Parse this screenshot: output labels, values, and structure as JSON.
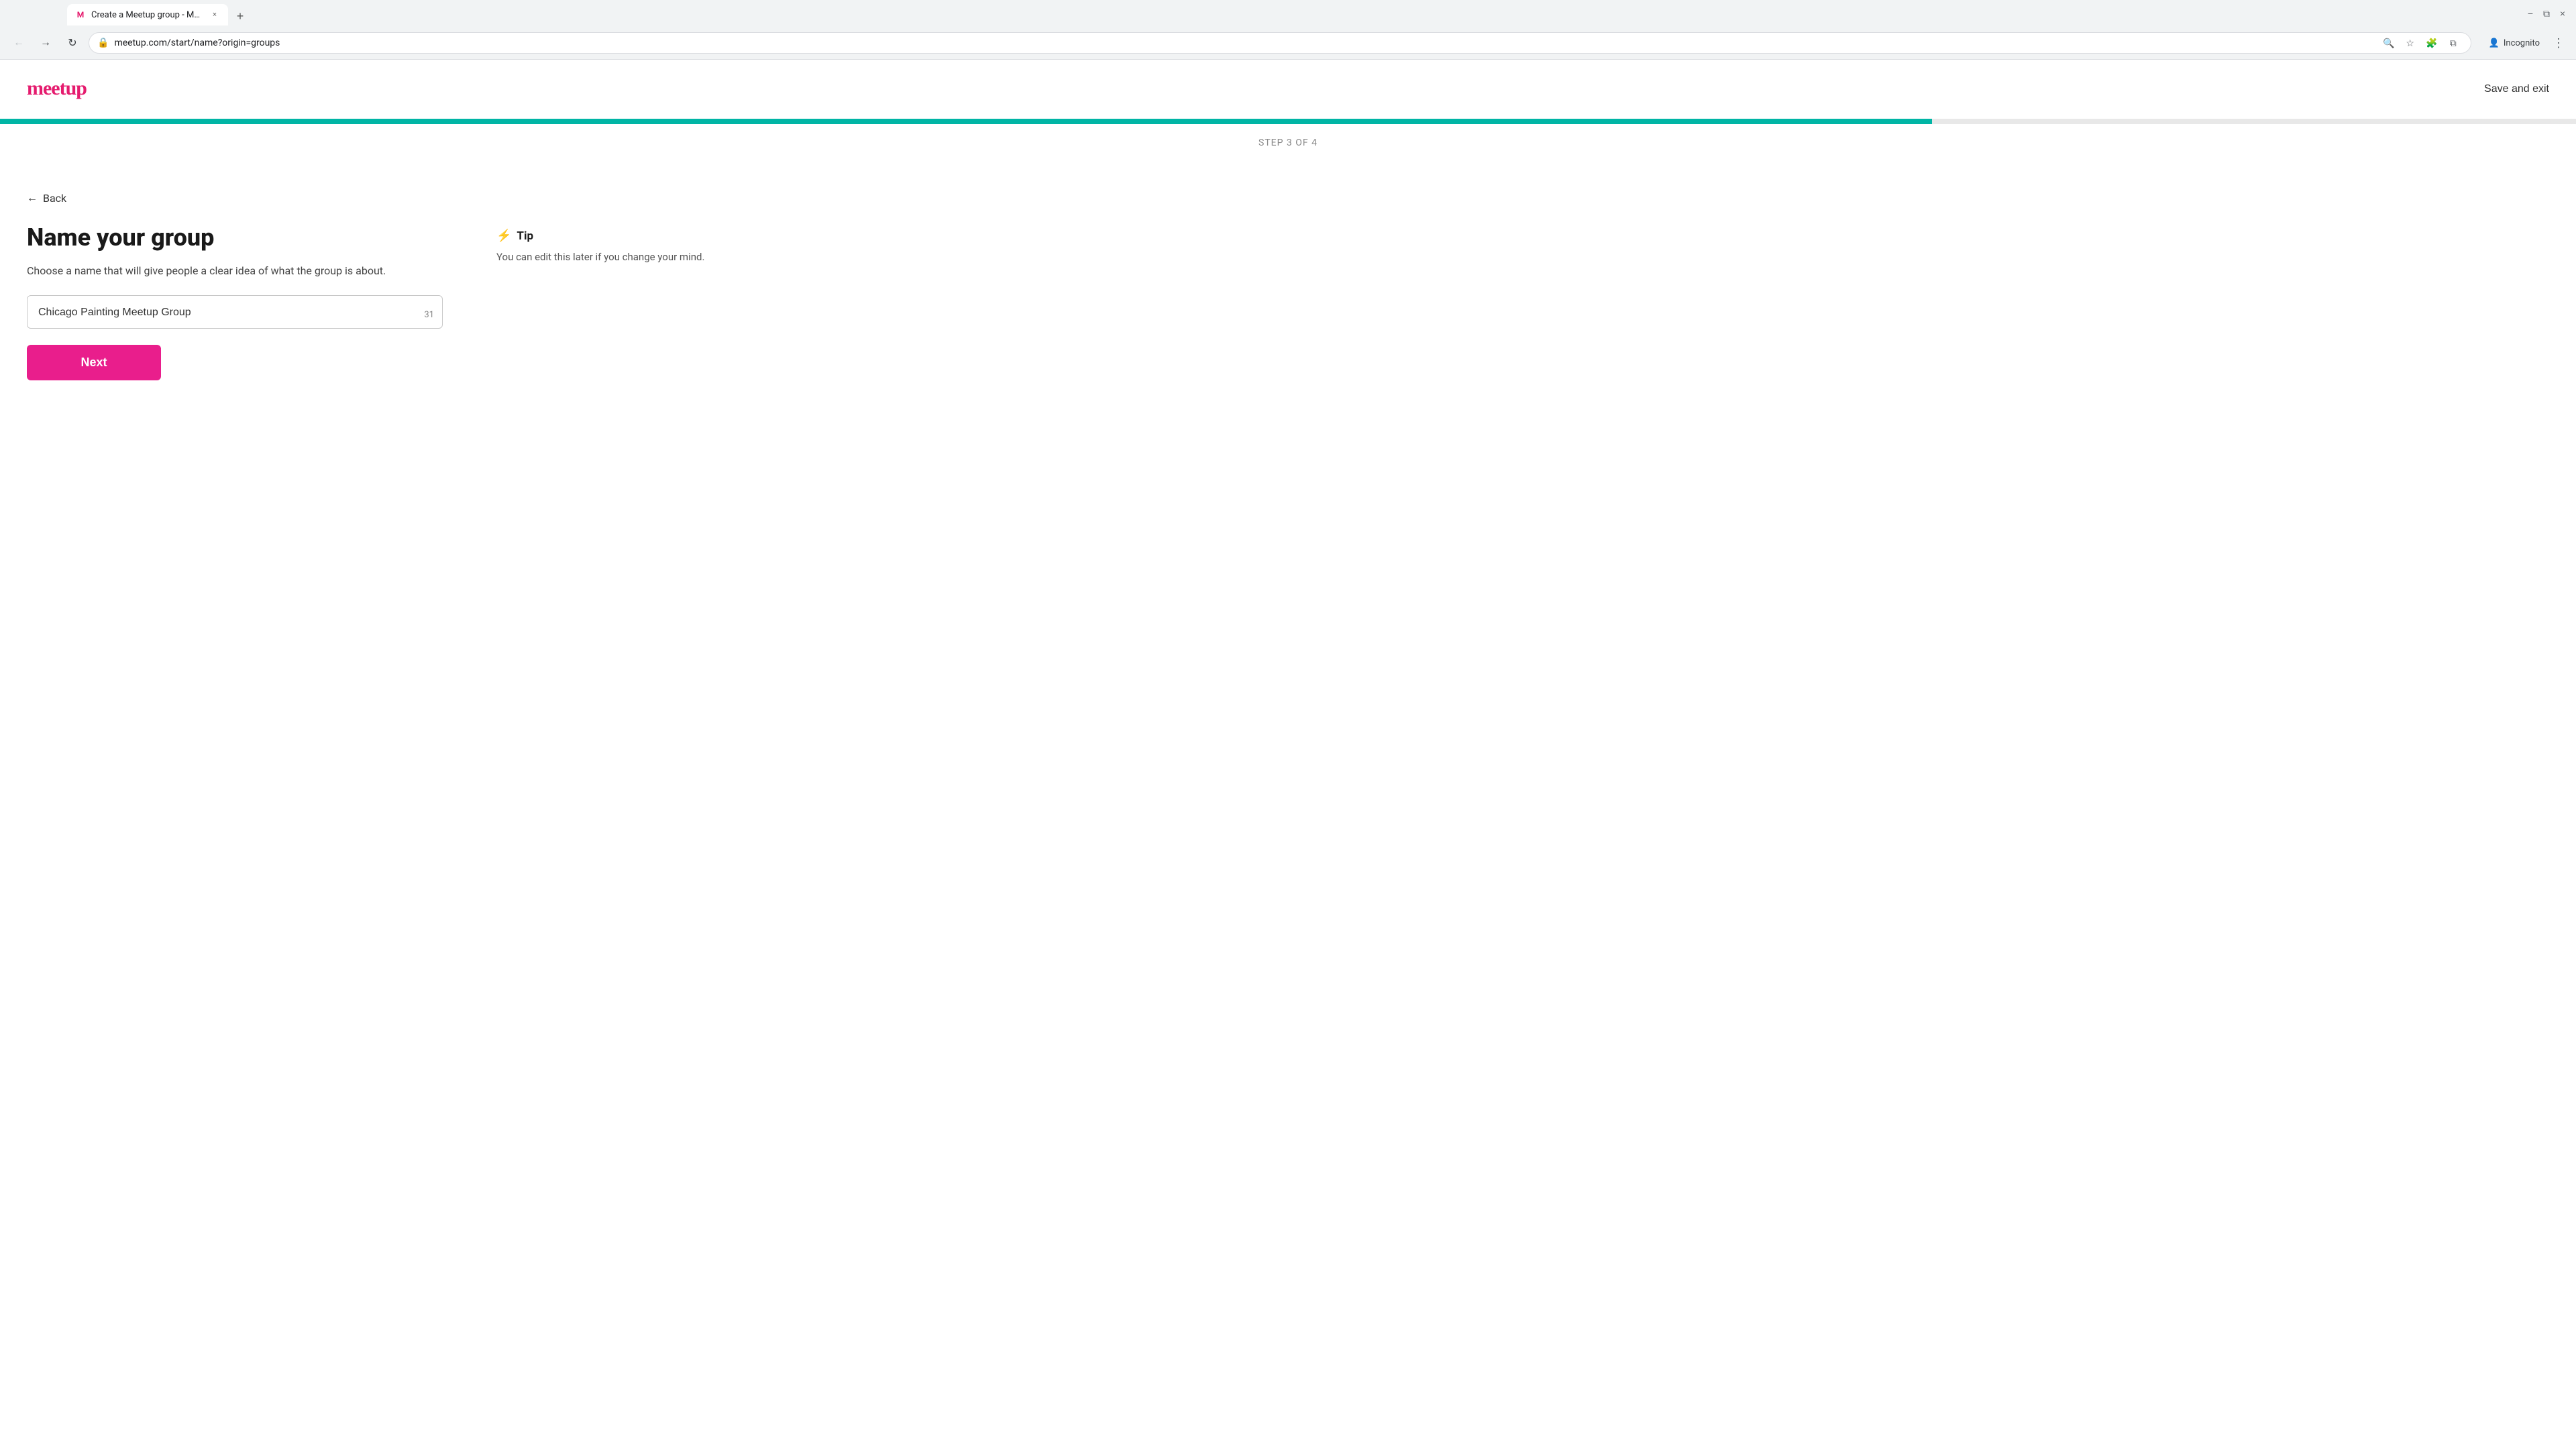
{
  "browser": {
    "tab_title": "Create a Meetup group - Meet...",
    "tab_favicon": "M",
    "url": "meetup.com/start/name?origin=groups",
    "close_symbol": "×",
    "new_tab_symbol": "+",
    "back_symbol": "←",
    "forward_symbol": "→",
    "refresh_symbol": "↻",
    "search_icon": "🔍",
    "bookmark_icon": "☆",
    "extensions_icon": "🧩",
    "split_icon": "⧉",
    "incognito_label": "Incognito",
    "incognito_icon": "👤",
    "menu_icon": "⋮",
    "minimize_label": "−",
    "maximize_label": "□",
    "close_window_label": "×"
  },
  "header": {
    "logo_text": "meetup",
    "save_exit_label": "Save and exit"
  },
  "progress": {
    "fill_percent": 75
  },
  "page": {
    "step_label": "STEP 3 OF 4",
    "back_label": "Back",
    "title": "Name your group",
    "description": "Choose a name that will give people a clear idea of what the group is about.",
    "input_value": "Chicago Painting Meetup Group",
    "input_placeholder": "",
    "char_count": "31",
    "next_button_label": "Next"
  },
  "tip": {
    "icon": "⚡",
    "title": "Tip",
    "text": "You can edit this later if you change your mind."
  }
}
